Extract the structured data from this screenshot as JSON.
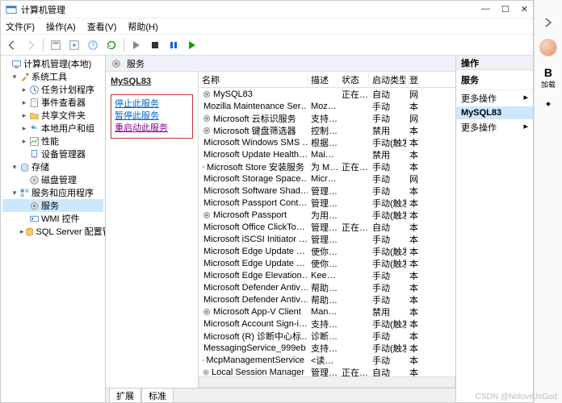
{
  "window": {
    "title": "计算机管理",
    "buttons": {
      "min": "—",
      "max": "☐",
      "close": "✕"
    }
  },
  "menu": [
    "文件(F)",
    "操作(A)",
    "查看(V)",
    "帮助(H)"
  ],
  "center_header": "服务",
  "tree": [
    {
      "label": "计算机管理(本地)",
      "depth": 0,
      "arrow": "",
      "icon": "computer"
    },
    {
      "label": "系统工具",
      "depth": 1,
      "arrow": "▾",
      "icon": "tools"
    },
    {
      "label": "任务计划程序",
      "depth": 2,
      "arrow": "▸",
      "icon": "clock"
    },
    {
      "label": "事件查看器",
      "depth": 2,
      "arrow": "▸",
      "icon": "event"
    },
    {
      "label": "共享文件夹",
      "depth": 2,
      "arrow": "▸",
      "icon": "folder"
    },
    {
      "label": "本地用户和组",
      "depth": 2,
      "arrow": "▸",
      "icon": "users"
    },
    {
      "label": "性能",
      "depth": 2,
      "arrow": "▸",
      "icon": "perf"
    },
    {
      "label": "设备管理器",
      "depth": 2,
      "arrow": "",
      "icon": "device"
    },
    {
      "label": "存储",
      "depth": 1,
      "arrow": "▾",
      "icon": "storage"
    },
    {
      "label": "磁盘管理",
      "depth": 2,
      "arrow": "",
      "icon": "disk"
    },
    {
      "label": "服务和应用程序",
      "depth": 1,
      "arrow": "▾",
      "icon": "apps"
    },
    {
      "label": "服务",
      "depth": 2,
      "arrow": "",
      "icon": "gear",
      "selected": true
    },
    {
      "label": "WMI 控件",
      "depth": 2,
      "arrow": "",
      "icon": "wmi"
    },
    {
      "label": "SQL Server 配置管理器",
      "depth": 2,
      "arrow": "▸",
      "icon": "sql"
    }
  ],
  "detail": {
    "name": "MySQL83",
    "actions": {
      "stop": "停止此服务",
      "pause": "暂停此服务",
      "restart": "重启动此服务"
    }
  },
  "columns": {
    "name": "名称",
    "desc": "描述",
    "status": "状态",
    "startup": "启动类型",
    "logon": "登"
  },
  "rows": [
    {
      "name": "MySQL83",
      "desc": "",
      "status": "正在…",
      "startup": "自动",
      "logon": "网"
    },
    {
      "name": "Mozilla Maintenance Ser…",
      "desc": "Moz…",
      "status": "",
      "startup": "手动",
      "logon": "本"
    },
    {
      "name": "Microsoft 云标识服务",
      "desc": "支持…",
      "status": "",
      "startup": "手动",
      "logon": "网"
    },
    {
      "name": "Microsoft 键盘筛选器",
      "desc": "控制…",
      "status": "",
      "startup": "禁用",
      "logon": "本"
    },
    {
      "name": "Microsoft Windows SMS …",
      "desc": "根据…",
      "status": "",
      "startup": "手动(触发…",
      "logon": "本"
    },
    {
      "name": "Microsoft Update Health…",
      "desc": "Mai…",
      "status": "",
      "startup": "禁用",
      "logon": "本"
    },
    {
      "name": "Microsoft Store 安装服务",
      "desc": "为 M…",
      "status": "正在…",
      "startup": "手动",
      "logon": "本"
    },
    {
      "name": "Microsoft Storage Space…",
      "desc": "Micr…",
      "status": "",
      "startup": "手动",
      "logon": "网"
    },
    {
      "name": "Microsoft Software Shad…",
      "desc": "管理…",
      "status": "",
      "startup": "手动",
      "logon": "本"
    },
    {
      "name": "Microsoft Passport Cont…",
      "desc": "管理…",
      "status": "",
      "startup": "手动(触发…",
      "logon": "本"
    },
    {
      "name": "Microsoft Passport",
      "desc": "为用…",
      "status": "",
      "startup": "手动(触发…",
      "logon": "本"
    },
    {
      "name": "Microsoft Office ClickTo…",
      "desc": "管理…",
      "status": "正在…",
      "startup": "自动",
      "logon": "本"
    },
    {
      "name": "Microsoft iSCSI Initiator …",
      "desc": "管理…",
      "status": "",
      "startup": "手动",
      "logon": "本"
    },
    {
      "name": "Microsoft Edge Update …",
      "desc": "使你…",
      "status": "",
      "startup": "手动(触发…",
      "logon": "本"
    },
    {
      "name": "Microsoft Edge Update …",
      "desc": "使你…",
      "status": "",
      "startup": "手动(触发…",
      "logon": "本"
    },
    {
      "name": "Microsoft Edge Elevation…",
      "desc": "Kee…",
      "status": "",
      "startup": "手动",
      "logon": "本"
    },
    {
      "name": "Microsoft Defender Antiv…",
      "desc": "帮助…",
      "status": "",
      "startup": "手动",
      "logon": "本"
    },
    {
      "name": "Microsoft Defender Antiv…",
      "desc": "帮助…",
      "status": "",
      "startup": "手动",
      "logon": "本"
    },
    {
      "name": "Microsoft App-V Client",
      "desc": "Man…",
      "status": "",
      "startup": "禁用",
      "logon": "本"
    },
    {
      "name": "Microsoft Account Sign-i…",
      "desc": "支持…",
      "status": "",
      "startup": "手动(触发…",
      "logon": "本"
    },
    {
      "name": "Microsoft (R) 诊断中心标…",
      "desc": "诊断…",
      "status": "",
      "startup": "手动",
      "logon": "本"
    },
    {
      "name": "MessagingService_999eb",
      "desc": "支持…",
      "status": "",
      "startup": "手动(触发…",
      "logon": "本"
    },
    {
      "name": "McpManagementService",
      "desc": "<读…",
      "status": "",
      "startup": "手动",
      "logon": "本"
    },
    {
      "name": "Local Session Manager",
      "desc": "管理…",
      "status": "正在…",
      "startup": "自动",
      "logon": "本"
    }
  ],
  "tabs": [
    "扩展",
    "标准"
  ],
  "actions_pane": {
    "header": "操作",
    "section1": "服务",
    "more1": "更多操作",
    "section2": "MySQL83",
    "more2": "更多操作"
  },
  "sidebar": {
    "letter": "B",
    "label": "加载"
  },
  "watermark": "CSDN @NoloveJsGod"
}
